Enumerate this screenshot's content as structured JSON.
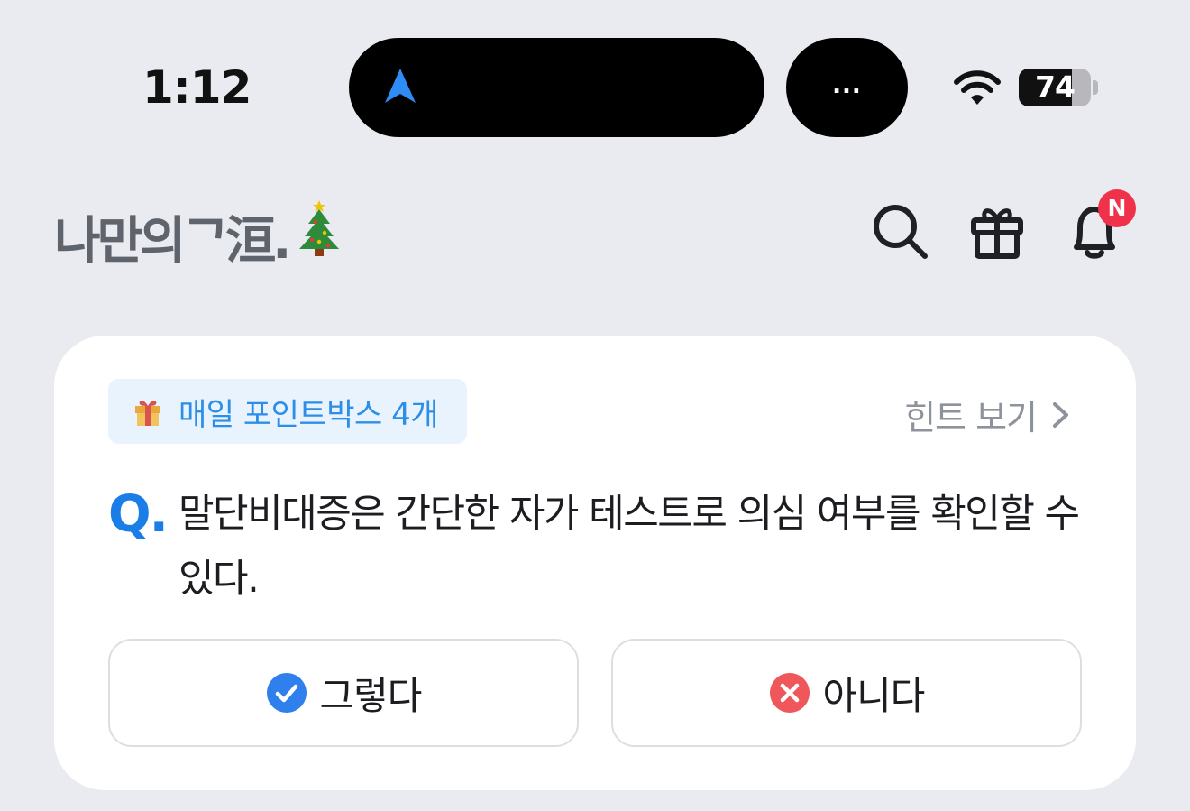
{
  "status_bar": {
    "time": "1:12",
    "island_more": "...",
    "battery_percent": 74,
    "battery_label": "74"
  },
  "header": {
    "logo_text": "나만의ᄀ洹.",
    "icons": [
      "search-icon",
      "gift-icon",
      "bell-icon"
    ],
    "notification_badge": "N"
  },
  "quiz": {
    "daily_points": "매일 포인트박스 4개",
    "hint_label": "힌트 보기",
    "question_prefix": "Q.",
    "question_text": "말단비대증은 간단한 자가 테스트로 의심 여부를 확인할 수 있다.",
    "answers": [
      {
        "label": "그렇다",
        "icon": "check-icon",
        "color": "#2f80ed"
      },
      {
        "label": "아니다",
        "icon": "x-icon",
        "color": "#f0575b"
      }
    ]
  },
  "colors": {
    "background": "#e9ebf0",
    "accent_blue": "#1b7ee6",
    "badge_red": "#f0314a"
  }
}
